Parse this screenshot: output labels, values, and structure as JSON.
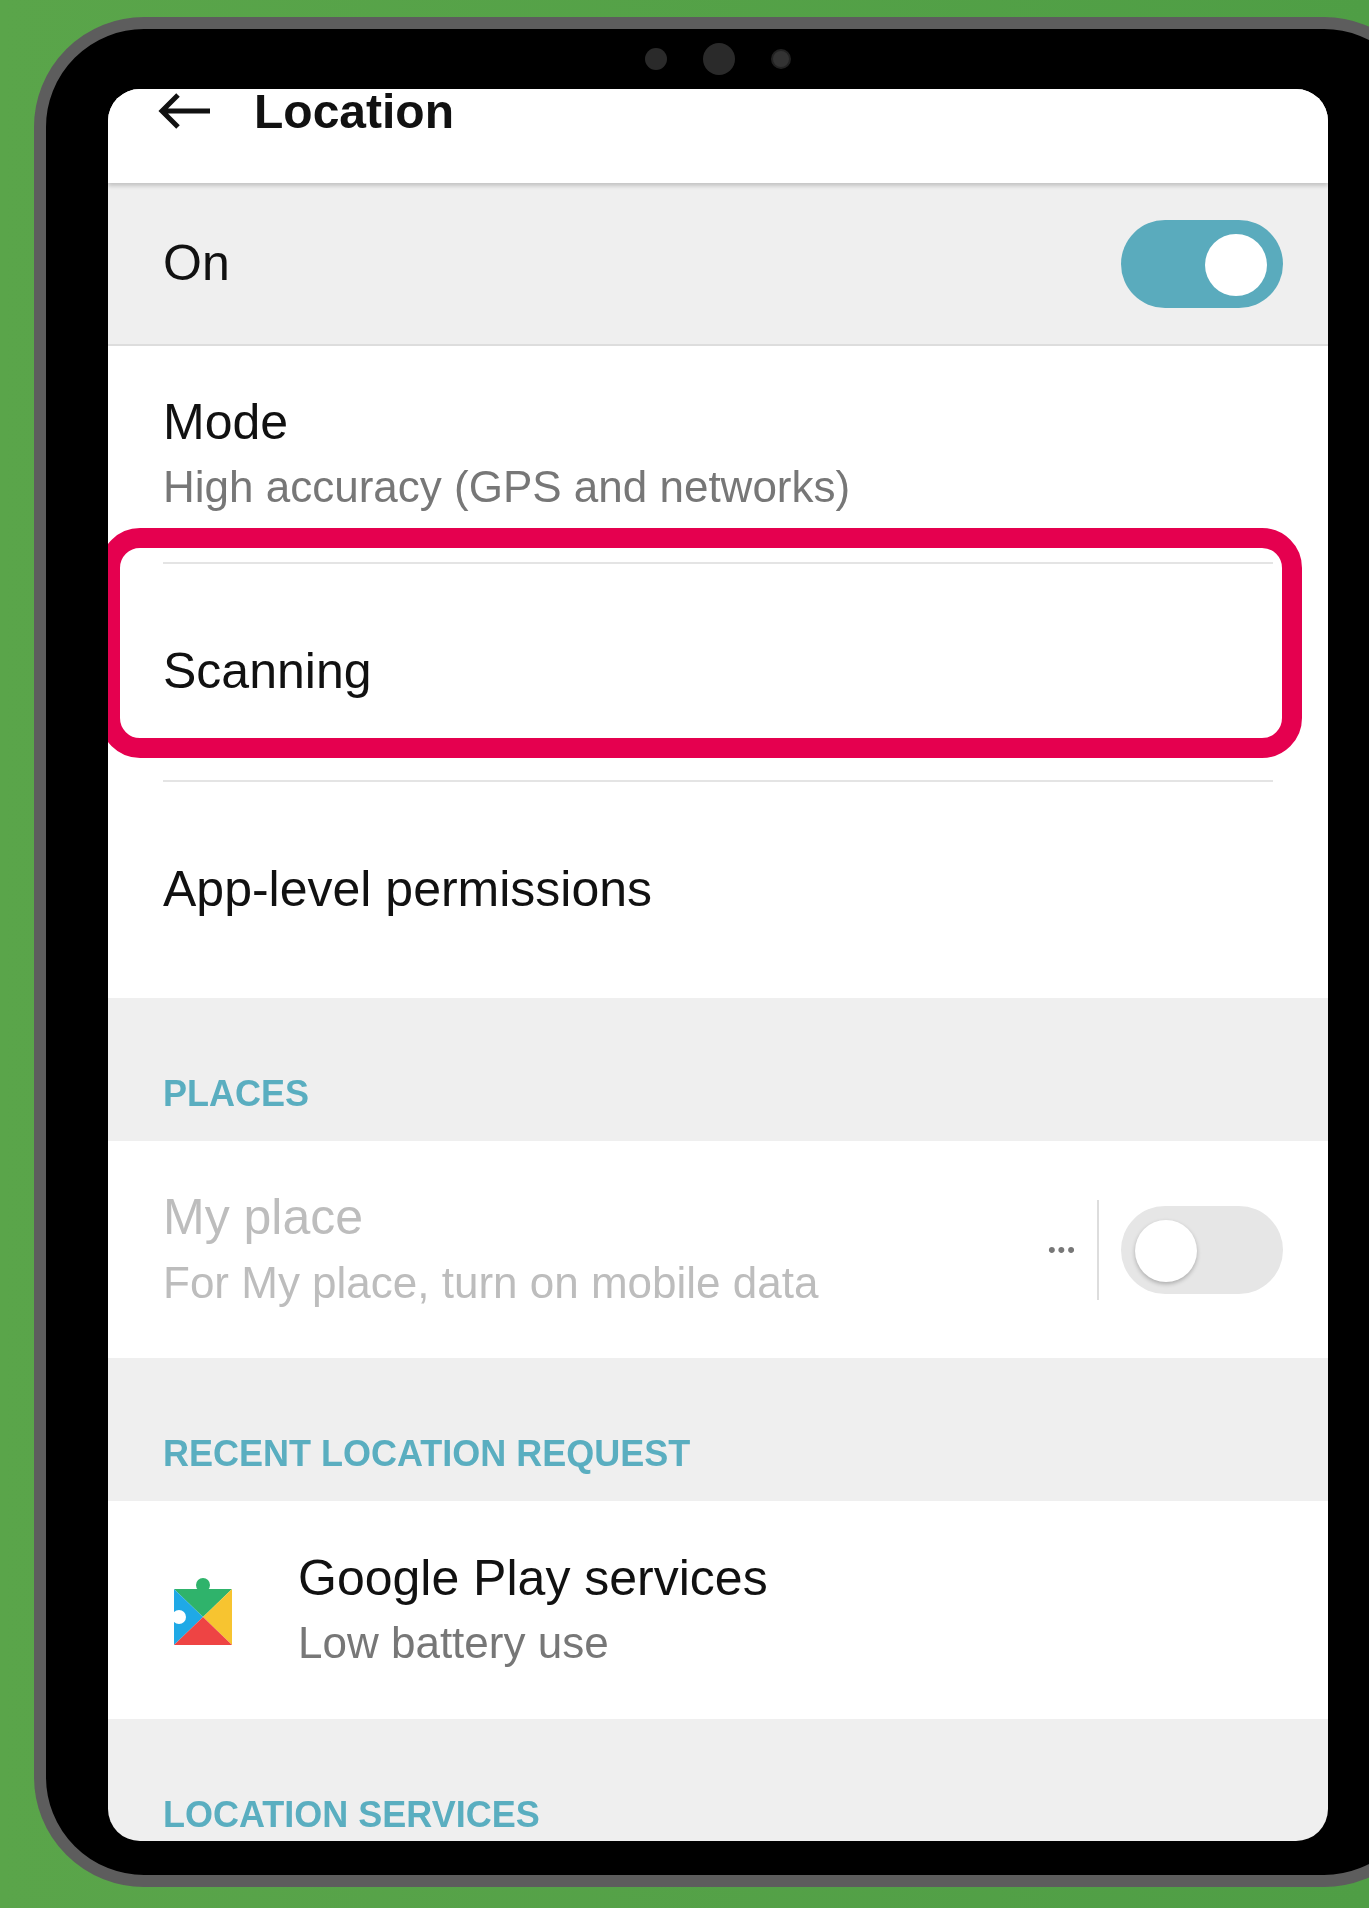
{
  "header": {
    "title": "Location"
  },
  "master_switch": {
    "label": "On",
    "on": true
  },
  "settings": [
    {
      "kind": "detail",
      "title": "Mode",
      "subtitle": "High accuracy (GPS and networks)",
      "highlighted": false
    },
    {
      "kind": "simple",
      "title": "Scanning",
      "highlighted": true
    },
    {
      "kind": "simple",
      "title": "App-level permissions",
      "highlighted": false
    }
  ],
  "places": {
    "heading": "PLACES",
    "items": [
      {
        "title": "My place",
        "subtitle": "For My place, turn on mobile data",
        "disabled": true,
        "on": false,
        "menu": "•••"
      }
    ]
  },
  "recent": {
    "heading": "RECENT LOCATION REQUEST",
    "items": [
      {
        "title": "Google Play services",
        "subtitle": "Low battery use"
      }
    ]
  },
  "services": {
    "heading": "LOCATION SERVICES"
  }
}
